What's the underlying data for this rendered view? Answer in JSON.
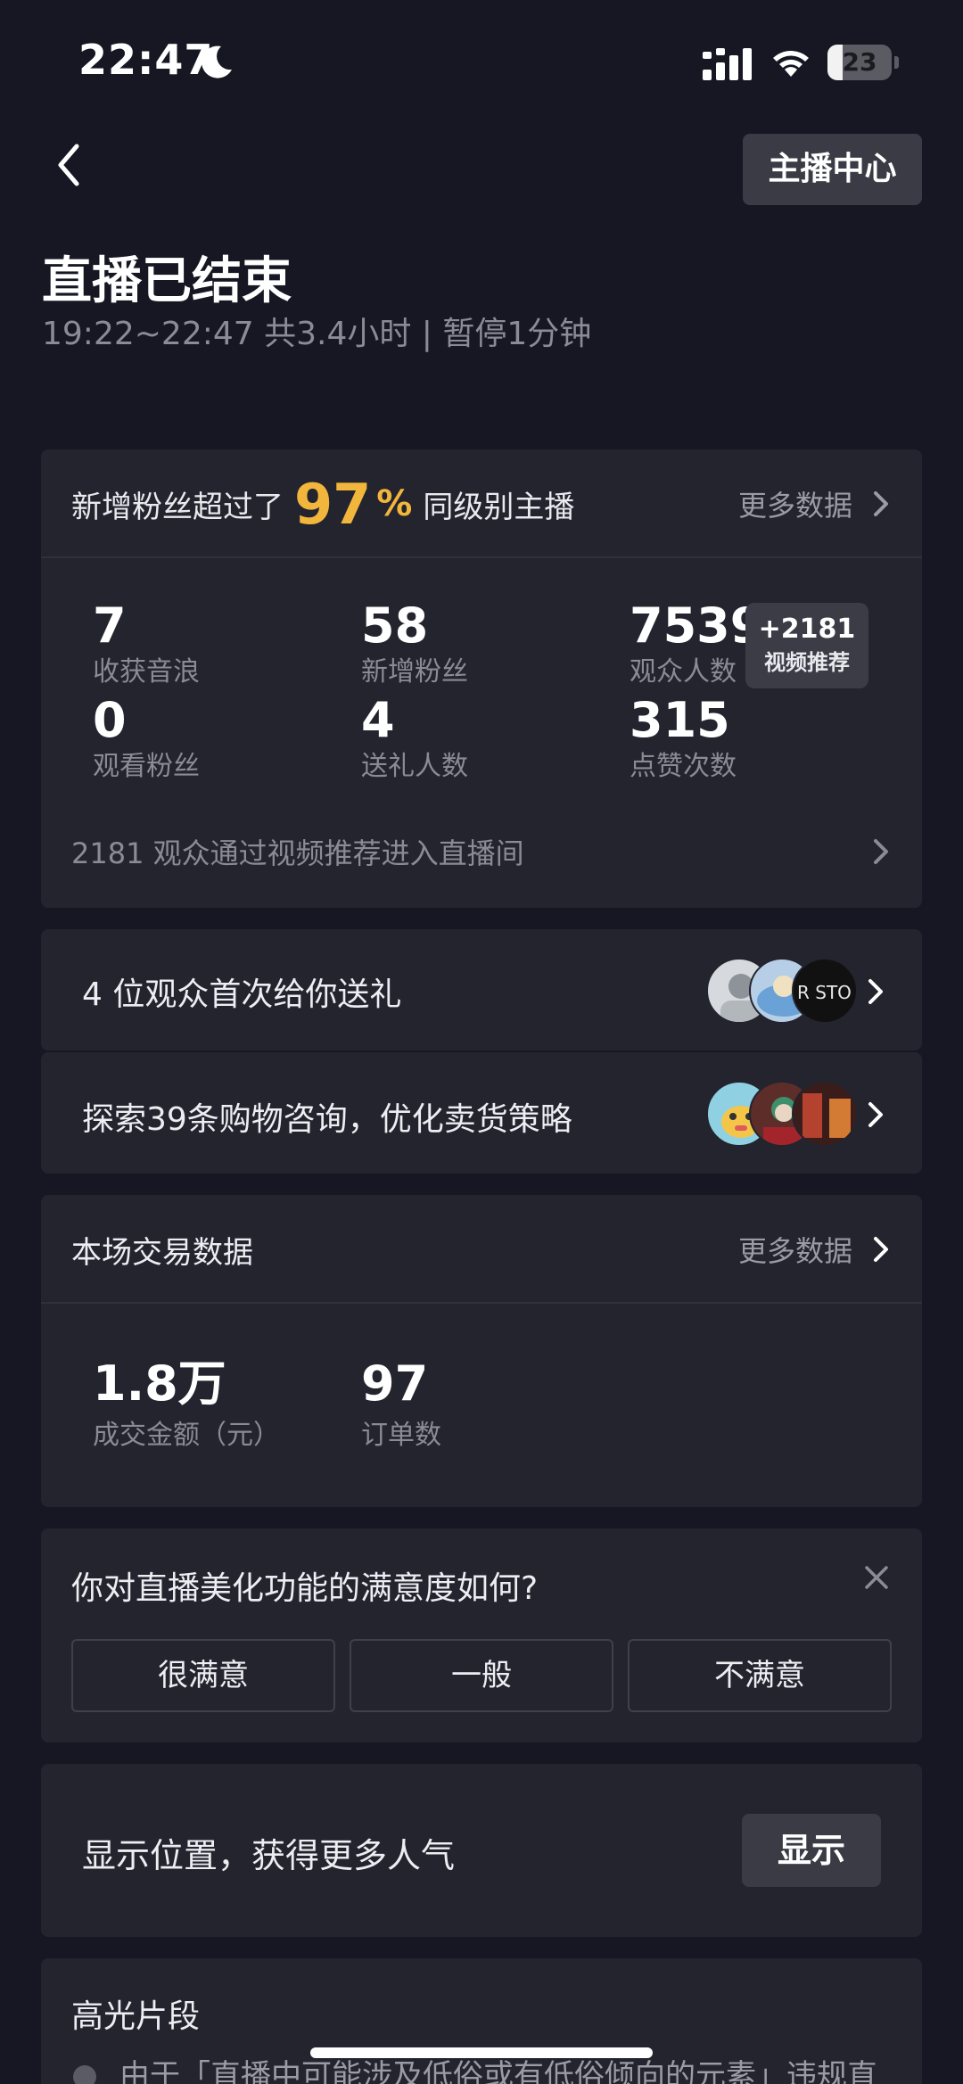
{
  "status_bar": {
    "time": "22:47",
    "battery": "23",
    "battery_level": 0.23
  },
  "header": {
    "back_icon": "chevron-left-icon",
    "anchor_center": "主播中心"
  },
  "title": "直播已结束",
  "subtitle": "19:22~22:47 共3.4小时 | 暂停1分钟",
  "fans_card": {
    "prefix": "新增粉丝超过了",
    "percent": "97",
    "percent_sign": "%",
    "suffix": "同级别主播",
    "more": "更多数据",
    "stats": [
      {
        "value": "7",
        "label": "收获音浪"
      },
      {
        "value": "58",
        "label": "新增粉丝"
      },
      {
        "value": "7539",
        "label": "观众人数"
      },
      {
        "value": "0",
        "label": "观看粉丝"
      },
      {
        "value": "4",
        "label": "送礼人数"
      },
      {
        "value": "315",
        "label": "点赞次数"
      }
    ],
    "rec_badge": {
      "value": "+2181",
      "label": "视频推荐"
    },
    "video_enter": "2181 观众通过视频推荐进入直播间"
  },
  "gift_row": {
    "text": "4 位观众首次给你送礼",
    "avatar_text": "R STO"
  },
  "shop_row": {
    "text": "探索39条购物咨询，优化卖货策略"
  },
  "trade_card": {
    "title": "本场交易数据",
    "more": "更多数据",
    "stats": [
      {
        "value": "1.8万",
        "label": "成交金额（元）"
      },
      {
        "value": "97",
        "label": "订单数"
      }
    ]
  },
  "survey": {
    "question": "你对直播美化功能的满意度如何?",
    "options": [
      "很满意",
      "一般",
      "不满意"
    ]
  },
  "location": {
    "text": "显示位置，获得更多人气",
    "button": "显示"
  },
  "highlights": {
    "title": "高光片段",
    "notice": "由于「直播中可能涉及低俗或有低俗倾向的元素」违规直"
  },
  "colors": {
    "background": "#161722",
    "card": "#23242e",
    "accent": "#f2b63c"
  }
}
